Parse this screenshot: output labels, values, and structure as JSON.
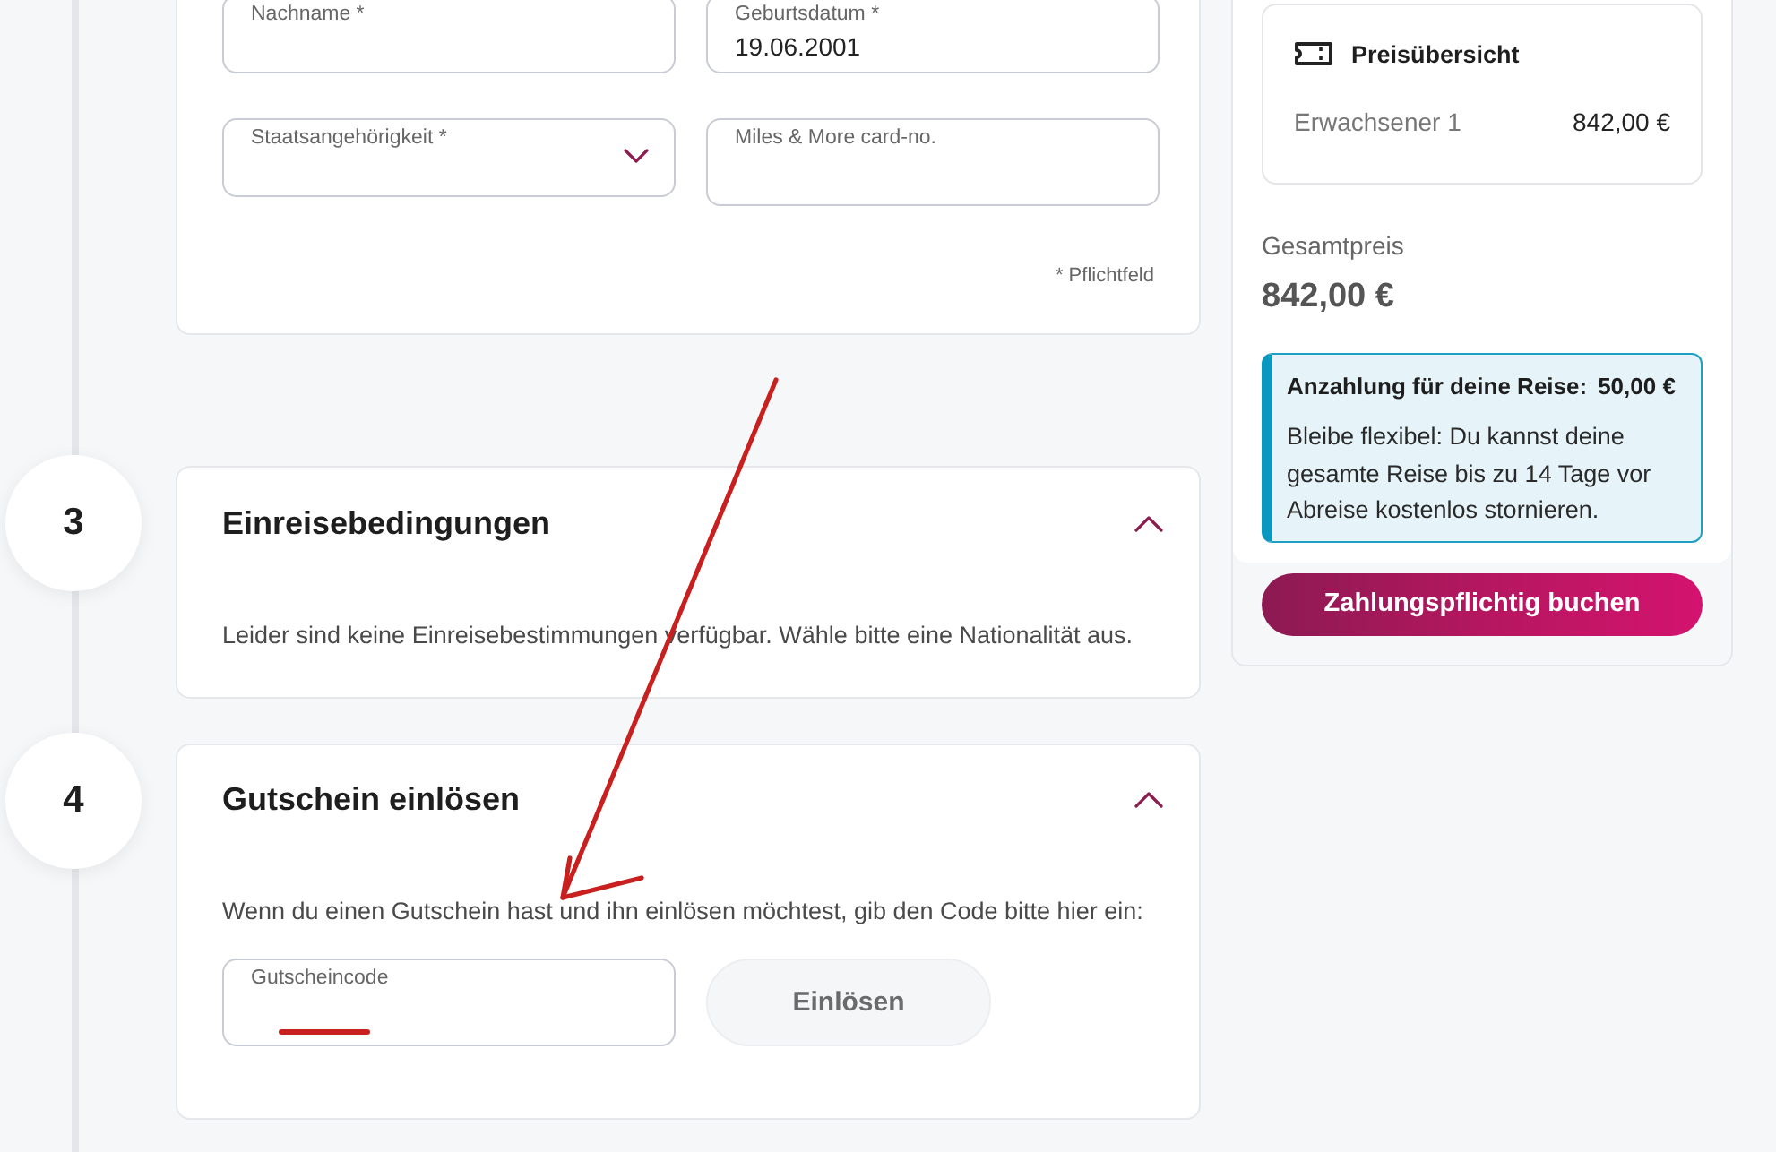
{
  "personal_data": {
    "fields": [
      {
        "kind": "text",
        "label": "Nachname *"
      },
      {
        "kind": "text",
        "label": "Geburtsdatum *",
        "value": "19.06.2001"
      },
      {
        "kind": "select",
        "label": "Staatsangehörigkeit *"
      },
      {
        "kind": "text",
        "label": "Miles & More card-no."
      }
    ],
    "required_note": "* Pflichtfeld"
  },
  "sections": [
    {
      "step": "3",
      "title": "Einreisebedingungen",
      "expanded": true,
      "text": "Leider sind keine Einreisebestimmungen verfügbar. Wähle bitte eine Nationalität aus."
    },
    {
      "step": "4",
      "title": "Gutschein einlösen",
      "expanded": true,
      "text": "Wenn du einen Gutschein hast und ihn einlösen möchtest, gib den Code bitte hier ein:",
      "voucher_field": {
        "label": "Gutscheincode"
      },
      "redeem_button": "Einlösen"
    }
  ],
  "summary": {
    "price_overview": {
      "title": "Preisübersicht",
      "lines": [
        {
          "label": "Erwachsener 1",
          "amount": "842,00 €"
        }
      ]
    },
    "total_label": "Gesamtpreis",
    "total": "842,00 €",
    "deposit": {
      "title": "Anzahlung für deine Reise:",
      "amount": "50,00 €",
      "text": "Bleibe flexibel: Du kannst deine gesamte Reise bis zu 14 Tage vor Abreise kostenlos stornieren."
    },
    "book_button": "Zahlungspflichtig buchen"
  }
}
